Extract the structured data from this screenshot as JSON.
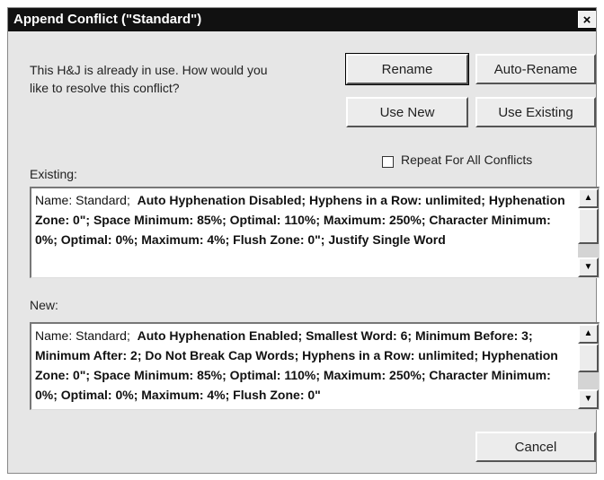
{
  "dialog": {
    "title": "Append Conflict (\"Standard\")",
    "close_label": "×",
    "message": "This H&J is already in use. How would you like to resolve this conflict?"
  },
  "buttons": {
    "rename": "Rename",
    "auto_rename": "Auto-Rename",
    "use_new": "Use New",
    "use_existing": "Use Existing",
    "cancel": "Cancel"
  },
  "checkbox": {
    "label": "Repeat For All Conflicts",
    "checked": false
  },
  "existing": {
    "label": "Existing:",
    "name": "Name: Standard;",
    "details": "Auto Hyphenation Disabled;  Hyphens in a Row: unlimited;  Hyphenation Zone: 0\";  Space Minimum: 85%;  Optimal: 110%;  Maximum: 250%;  Character Minimum: 0%;  Optimal: 0%;  Maximum: 4%;  Flush Zone: 0\";  Justify Single Word"
  },
  "new": {
    "label": "New:",
    "name": "Name: Standard;",
    "details": "Auto Hyphenation Enabled;  Smallest Word: 6;  Minimum Before: 3;  Minimum After: 2;  Do Not Break Cap Words;  Hyphens in a Row: unlimited;  Hyphenation Zone: 0\";  Space Minimum: 85%;  Optimal: 110%;  Maximum: 250%;  Character Minimum: 0%;  Optimal: 0%;  Maximum: 4%;  Flush Zone: 0\""
  },
  "icons": {
    "scroll_up": "scroll-up-arrow",
    "scroll_down": "scroll-down-arrow"
  },
  "colors": {
    "titlebar": "#111111",
    "dialog_bg": "#e6e6e6"
  }
}
